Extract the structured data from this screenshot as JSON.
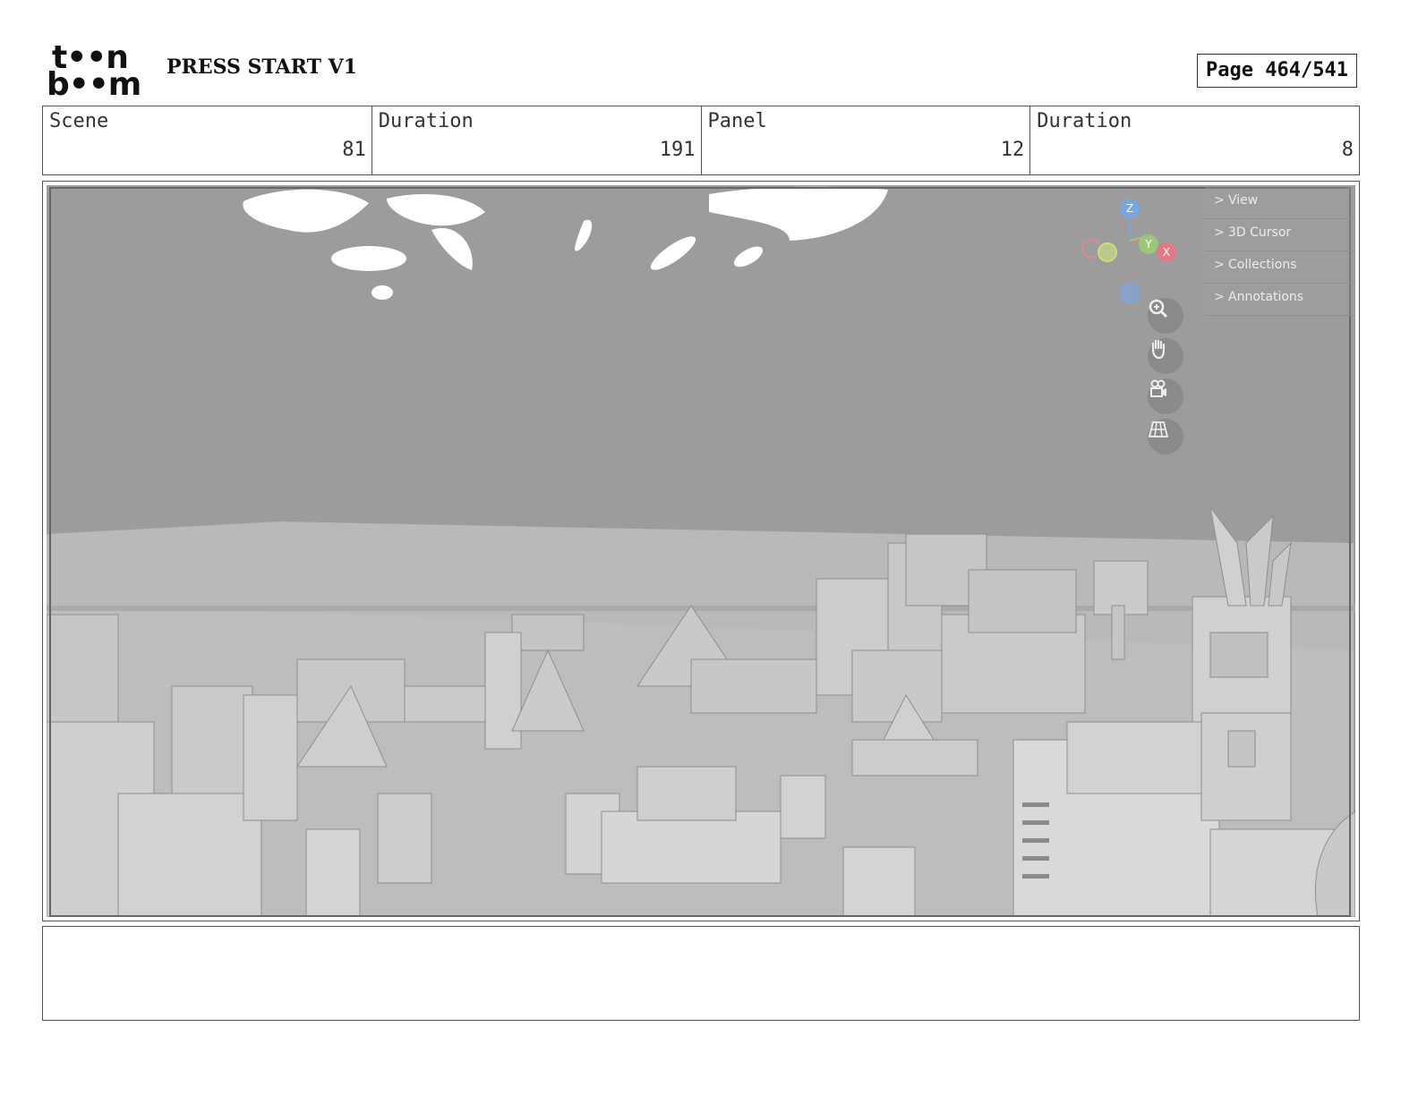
{
  "header": {
    "logo_line1": "t••n",
    "logo_line2": "b••m",
    "title": "PRESS START V1",
    "page": "Page 464/541"
  },
  "info": {
    "scene_label": "Scene",
    "scene_value": "81",
    "duration_label": "Duration",
    "duration_value": "191",
    "panel_label": "Panel",
    "panel_value": "12",
    "panel_duration_label": "Duration",
    "panel_duration_value": "8"
  },
  "viewport": {
    "sidebar_items": [
      "View",
      "3D Cursor",
      "Collections",
      "Annotations"
    ],
    "gizmo": {
      "z": "Z",
      "y": "Y",
      "x": "X"
    },
    "tools": [
      "zoom-icon",
      "hand-pan-icon",
      "camera-icon",
      "grid-perspective-icon"
    ],
    "colors": {
      "z_axis": "#7aa6e0",
      "y_axis": "#9cc77a",
      "x_axis": "#e07a86",
      "sky": "#9c9c9c"
    }
  },
  "notes": {
    "text": ""
  }
}
